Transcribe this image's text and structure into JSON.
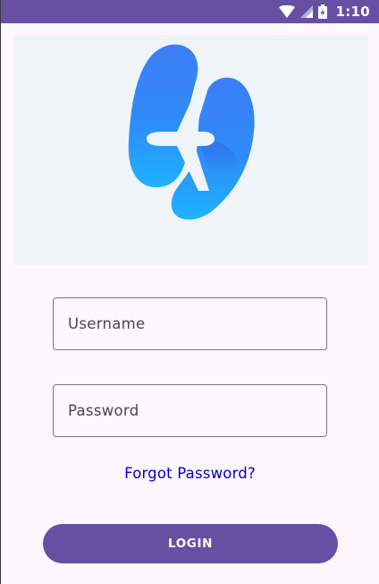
{
  "status_bar": {
    "time": "1:10",
    "icons": [
      "wifi-icon",
      "signal-icon",
      "battery-charging-icon"
    ]
  },
  "hero": {
    "logo": "airplane-footprints-logo"
  },
  "form": {
    "username_placeholder": "Username",
    "password_placeholder": "Password",
    "forgot_password_label": "Forgot Password?",
    "login_label": "LOGIN"
  },
  "colors": {
    "primary": "#6750a4",
    "background": "#fef7ff",
    "hero_background": "#eff4f9",
    "link": "#0000cc",
    "outline": "#79747e",
    "logo_light": "#1fb0ff",
    "logo_dark": "#3578f5"
  }
}
